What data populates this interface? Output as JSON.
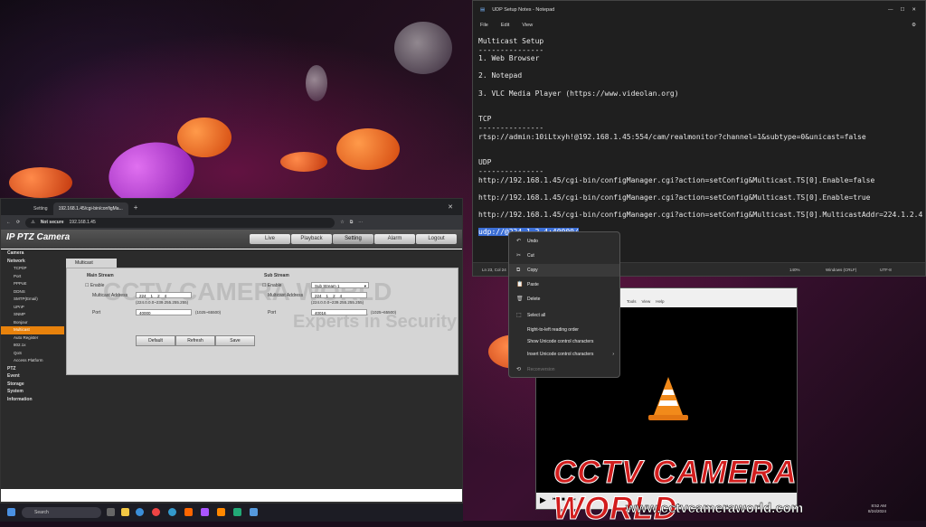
{
  "browser": {
    "tabs": [
      "Setting",
      "192.168.1.45/cgi-bin/configMa..."
    ],
    "not_secure": "Not secure",
    "url": "192.168.1.45"
  },
  "camera": {
    "title": "IP PTZ Camera",
    "nav": [
      "Live",
      "Playback",
      "Setting",
      "Alarm",
      "Logout"
    ],
    "sidebar": [
      {
        "label": "Camera",
        "level": "top"
      },
      {
        "label": "Network",
        "level": "top"
      },
      {
        "label": "TCP/IP",
        "level": "sub"
      },
      {
        "label": "Port",
        "level": "sub"
      },
      {
        "label": "PPPoE",
        "level": "sub"
      },
      {
        "label": "DDNS",
        "level": "sub"
      },
      {
        "label": "SMTP(Email)",
        "level": "sub"
      },
      {
        "label": "UPnP",
        "level": "sub"
      },
      {
        "label": "SNMP",
        "level": "sub"
      },
      {
        "label": "Bonjour",
        "level": "sub"
      },
      {
        "label": "Multicast",
        "level": "sub",
        "active": true
      },
      {
        "label": "Auto Register",
        "level": "sub"
      },
      {
        "label": "802.1x",
        "level": "sub"
      },
      {
        "label": "QoS",
        "level": "sub"
      },
      {
        "label": "Access Platform",
        "level": "sub"
      },
      {
        "label": "PTZ",
        "level": "top"
      },
      {
        "label": "Event",
        "level": "top"
      },
      {
        "label": "Storage",
        "level": "top"
      },
      {
        "label": "System",
        "level": "top"
      },
      {
        "label": "Information",
        "level": "top"
      }
    ],
    "tab_label": "Multicast",
    "main_stream": {
      "title": "Main Stream",
      "enable": "Enable",
      "multicast_address_label": "Multicast Address",
      "address": [
        "224",
        "1",
        "2",
        "4"
      ],
      "address_hint": "(224.0.0.0~239.255.255.255)",
      "port_label": "Port",
      "port_value": "40000",
      "port_hint": "(1025~65500)"
    },
    "sub_stream": {
      "title": "Sub Stream",
      "enable": "Enable",
      "stream_select": "Sub Stream 1",
      "multicast_address_label": "Multicast Address",
      "address": [
        "224",
        "1",
        "2",
        "4"
      ],
      "address_hint": "(224.0.0.0~239.255.255.255)",
      "port_label": "Port",
      "port_value": "40016",
      "port_hint": "(1025~65500)"
    },
    "buttons": [
      "Default",
      "Refresh",
      "Save"
    ]
  },
  "notepad": {
    "title": "UDP Setup Notes - Notepad",
    "menu": [
      "File",
      "Edit",
      "View"
    ],
    "lines": [
      "Multicast Setup",
      "---------------",
      "1. Web Browser",
      "",
      "2. Notepad",
      "",
      "3. VLC Media Player (https://www.videolan.org)",
      "",
      "",
      "TCP",
      "---------------",
      "rtsp://admin:10iLtxyh!@192.168.1.45:554/cam/realmonitor?channel=1&subtype=0&unicast=false",
      "",
      "",
      "UDP",
      "---------------",
      "http://192.168.1.45/cgi-bin/configManager.cgi?action=setConfig&Multicast.TS[0].Enable=false",
      "",
      "http://192.168.1.45/cgi-bin/configManager.cgi?action=setConfig&Multicast.TS[0].Enable=true",
      "",
      "http://192.168.1.45/cgi-bin/configManager.cgi?action=setConfig&Multicast.TS[0].MulticastAddr=224.1.2.4",
      ""
    ],
    "selected_line": "udp://@224.1.2.4:40000/",
    "status": {
      "position": "Ln 23, Col 24",
      "zoom": "140%",
      "eol": "Windows (CRLF)",
      "encoding": "UTF-8"
    }
  },
  "context_menu": [
    "Undo",
    "Cut",
    "Copy",
    "Paste",
    "Delete",
    "Select all",
    "Right-to-left reading order",
    "Show Unicode control characters",
    "Insert Unicode control characters",
    "Reconversion"
  ],
  "vlc": {
    "menu": [
      "Tools",
      "View",
      "Help"
    ]
  },
  "taskbar": {
    "search": "Search",
    "time": "8:52 AM",
    "date": "8/24/2024"
  },
  "watermark": {
    "brand": "CCTV CAMERA WORLD",
    "url": "www.cctvcameraworld.com",
    "tagline": "Experts in Security"
  }
}
